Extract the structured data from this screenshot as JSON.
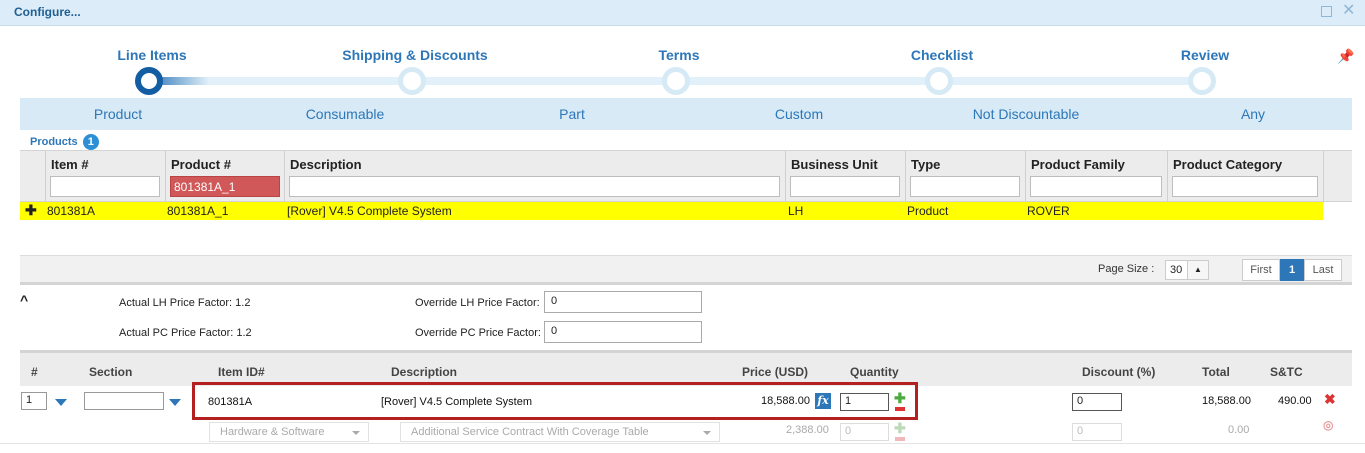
{
  "window": {
    "title": "Configure..."
  },
  "wizard": {
    "steps": [
      "Line Items",
      "Shipping & Discounts",
      "Terms",
      "Checklist",
      "Review"
    ],
    "active_step": 0
  },
  "categories": [
    "Product",
    "Consumable",
    "Part",
    "Custom",
    "Not Discountable",
    "Any"
  ],
  "products": {
    "label": "Products",
    "count": "1",
    "columns": [
      "Item #",
      "Product #",
      "Description",
      "Business Unit",
      "Type",
      "Product Family",
      "Product Category"
    ],
    "filters": [
      "",
      "801381A_1",
      "",
      "",
      "",
      "",
      ""
    ],
    "row": [
      "801381A",
      "801381A_1",
      "[Rover] V4.5 Complete System",
      "LH",
      "Product",
      "ROVER",
      ""
    ]
  },
  "pager": {
    "page_size_label": "Page Size :",
    "page_size": "30",
    "first": "First",
    "current": "1",
    "last": "Last"
  },
  "factors": {
    "actual_lh_label": "Actual LH Price Factor: 1.2",
    "actual_pc_label": "Actual PC Price Factor: 1.2",
    "override_lh_label": "Override LH Price Factor:",
    "override_lh_value": "0",
    "override_pc_label": "Override PC Price Factor:",
    "override_pc_value": "0"
  },
  "line_items": {
    "columns": {
      "num": "#",
      "section": "Section",
      "item_id": "Item ID#",
      "description": "Description",
      "price": "Price (USD)",
      "quantity": "Quantity",
      "discount": "Discount (%)",
      "total": "Total",
      "stc": "S&TC"
    },
    "row": {
      "num": "1",
      "section": "",
      "item_id": "801381A",
      "description": "[Rover] V4.5 Complete System",
      "price": "18,588.00",
      "fx": "fx",
      "quantity": "1",
      "discount": "0",
      "total": "18,588.00",
      "stc": "490.00"
    },
    "sub_row": {
      "category": "Hardware & Software",
      "service": "Additional Service Contract With Coverage Table",
      "price": "2,388.00",
      "quantity": "0",
      "discount": "0",
      "total": "0.00"
    }
  },
  "colors": {
    "accent": "#2d77b8",
    "highlight_row": "#ffff00",
    "selection_border": "#b42020"
  }
}
